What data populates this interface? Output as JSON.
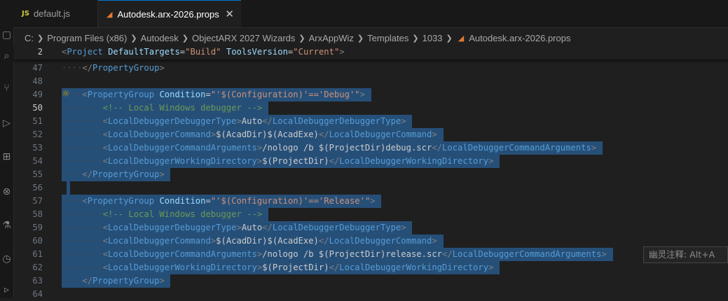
{
  "tabs": [
    {
      "icon": "JS",
      "label": "default.js"
    },
    {
      "label": "Autodesk.arx-2026.props"
    }
  ],
  "breadcrumb": [
    "C:",
    "Program Files (x86)",
    "Autodesk",
    "ObjectARX 2027 Wizards",
    "ArxAppWiz",
    "Templates",
    "1033",
    "Autodesk.arx-2026.props"
  ],
  "sticky": {
    "number": "2",
    "open": "<",
    "tag": "Project",
    "a1": "DefaultTargets",
    "v1": "\"Build\"",
    "a2": "ToolsVersion",
    "v2": "\"Current\"",
    "close": ">"
  },
  "lines": [
    {
      "n": "47",
      "indent": "    ",
      "t1": "</",
      "tag": "PropertyGroup",
      "t2": ">"
    },
    {
      "n": "48"
    },
    {
      "n": "49",
      "indent": "    ",
      "open": "<",
      "tag": "PropertyGroup",
      "attr": "Condition",
      "eq": "=",
      "val": "\"'$(Configuration)'=='Debug'\"",
      "close": ">"
    },
    {
      "n": "50",
      "indent": "        ",
      "comment": "<!-- Local Windows debugger -->"
    },
    {
      "n": "51",
      "indent": "        ",
      "open": "<",
      "tag": "LocalDebuggerDebuggerType",
      "close": ">",
      "text": "Auto",
      "endopen": "</",
      "endtag": "LocalDebuggerDebuggerType",
      "endclose": ">"
    },
    {
      "n": "52",
      "indent": "        ",
      "open": "<",
      "tag": "LocalDebuggerCommand",
      "close": ">",
      "text": "$(AcadDir)$(AcadExe)",
      "endopen": "</",
      "endtag": "LocalDebuggerCommand",
      "endclose": ">"
    },
    {
      "n": "53",
      "indent": "        ",
      "open": "<",
      "tag": "LocalDebuggerCommandArguments",
      "close": ">",
      "text": "/nologo /b $(ProjectDir)debug.scr",
      "endopen": "</",
      "endtag": "LocalDebuggerCommandArguments",
      "endclose": ">"
    },
    {
      "n": "54",
      "indent": "        ",
      "open": "<",
      "tag": "LocalDebuggerWorkingDirectory",
      "close": ">",
      "text": "$(ProjectDir)",
      "endopen": "</",
      "endtag": "LocalDebuggerWorkingDirectory",
      "endclose": ">"
    },
    {
      "n": "55",
      "indent": "    ",
      "t1": "</",
      "tag": "PropertyGroup",
      "t2": ">"
    },
    {
      "n": "56"
    },
    {
      "n": "57",
      "indent": "    ",
      "open": "<",
      "tag": "PropertyGroup",
      "attr": "Condition",
      "eq": "=",
      "val": "\"'$(Configuration)'=='Release'\"",
      "close": ">"
    },
    {
      "n": "58",
      "indent": "        ",
      "comment": "<!-- Local Windows debugger -->"
    },
    {
      "n": "59",
      "indent": "        ",
      "open": "<",
      "tag": "LocalDebuggerDebuggerType",
      "close": ">",
      "text": "Auto",
      "endopen": "</",
      "endtag": "LocalDebuggerDebuggerType",
      "endclose": ">"
    },
    {
      "n": "60",
      "indent": "        ",
      "open": "<",
      "tag": "LocalDebuggerCommand",
      "close": ">",
      "text": "$(AcadDir)$(AcadExe)",
      "endopen": "</",
      "endtag": "LocalDebuggerCommand",
      "endclose": ">"
    },
    {
      "n": "61",
      "indent": "        ",
      "open": "<",
      "tag": "LocalDebuggerCommandArguments",
      "close": ">",
      "text": "/nologo /b $(ProjectDir)release.scr",
      "endopen": "</",
      "endtag": "LocalDebuggerCommandArguments",
      "endclose": ">"
    },
    {
      "n": "62",
      "indent": "        ",
      "open": "<",
      "tag": "LocalDebuggerWorkingDirectory",
      "close": ">",
      "text": "$(ProjectDir)",
      "endopen": "</",
      "endtag": "LocalDebuggerWorkingDirectory",
      "endclose": ">"
    },
    {
      "n": "63",
      "indent": "    ",
      "t1": "</",
      "tag": "PropertyGroup",
      "t2": ">"
    },
    {
      "n": "64"
    }
  ],
  "hint": "幽灵注释: Alt+A",
  "colors": {
    "selection": "#264f78",
    "tag": "#569cd6",
    "attr": "#9cdcfe",
    "string": "#ce9178",
    "comment": "#6a9955"
  }
}
